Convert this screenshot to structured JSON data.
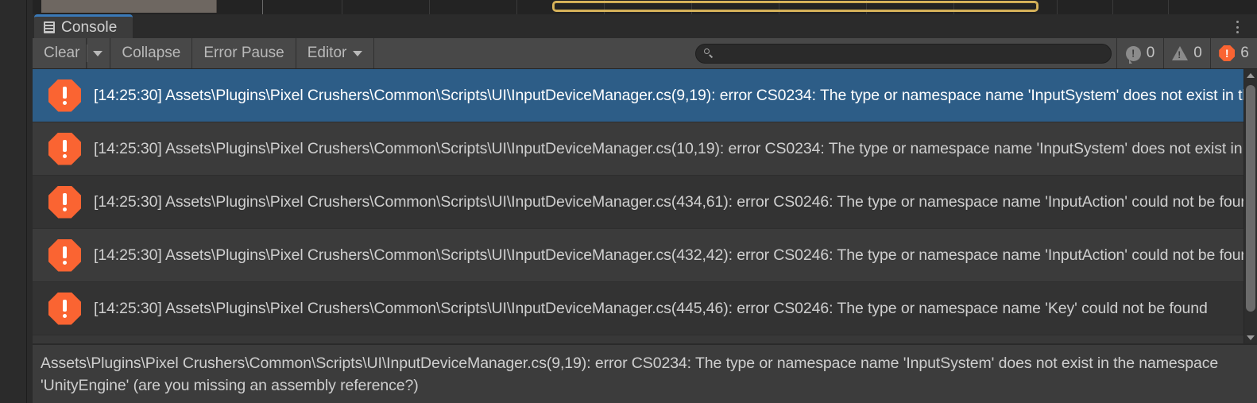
{
  "top_strip": {
    "selection_marker_color": "#d9b55c",
    "block_color": "#6e6761"
  },
  "tab": {
    "label": "Console",
    "icon": "console-icon"
  },
  "window_menu": {
    "icon": "kebab-menu-icon"
  },
  "toolbar": {
    "clear_label": "Clear",
    "clear_dropdown_icon": "chevron-down-icon",
    "collapse_label": "Collapse",
    "error_pause_label": "Error Pause",
    "editor_label": "Editor",
    "editor_dropdown_icon": "chevron-down-icon",
    "search": {
      "icon": "search-icon",
      "value": "",
      "placeholder": ""
    },
    "counters": [
      {
        "type": "info",
        "icon": "info-bubble-icon",
        "count": "0"
      },
      {
        "type": "warning",
        "icon": "warning-triangle-icon",
        "count": "0"
      },
      {
        "type": "error",
        "icon": "error-octagon-icon",
        "count": "6"
      }
    ]
  },
  "log_list": {
    "rows": [
      {
        "icon": "error-octagon-icon",
        "selected": true,
        "text": "[14:25:30] Assets\\Plugins\\Pixel Crushers\\Common\\Scripts\\UI\\InputDeviceManager.cs(9,19): error CS0234: The type or namespace name 'InputSystem' does not exist in the namespace 'UnityEngine'"
      },
      {
        "icon": "error-octagon-icon",
        "selected": false,
        "text": "[14:25:30] Assets\\Plugins\\Pixel Crushers\\Common\\Scripts\\UI\\InputDeviceManager.cs(10,19): error CS0234: The type or namespace name 'InputSystem' does not exist in the namespace 'UnityEngine'"
      },
      {
        "icon": "error-octagon-icon",
        "selected": false,
        "text": "[14:25:30] Assets\\Plugins\\Pixel Crushers\\Common\\Scripts\\UI\\InputDeviceManager.cs(434,61): error CS0246: The type or namespace name 'InputAction' could not be found"
      },
      {
        "icon": "error-octagon-icon",
        "selected": false,
        "text": "[14:25:30] Assets\\Plugins\\Pixel Crushers\\Common\\Scripts\\UI\\InputDeviceManager.cs(432,42): error CS0246: The type or namespace name 'InputAction' could not be found"
      },
      {
        "icon": "error-octagon-icon",
        "selected": false,
        "text": "[14:25:30] Assets\\Plugins\\Pixel Crushers\\Common\\Scripts\\UI\\InputDeviceManager.cs(445,46): error CS0246: The type or namespace name 'Key' could not be found"
      }
    ],
    "scrollbar": {
      "up_icon": "scroll-up-arrow-icon",
      "down_icon": "scroll-down-arrow-icon"
    }
  },
  "detail_pane": {
    "text": "Assets\\Plugins\\Pixel Crushers\\Common\\Scripts\\UI\\InputDeviceManager.cs(9,19): error CS0234: The type or namespace name 'InputSystem' does not exist in the namespace 'UnityEngine' (are you missing an assembly reference?)"
  }
}
